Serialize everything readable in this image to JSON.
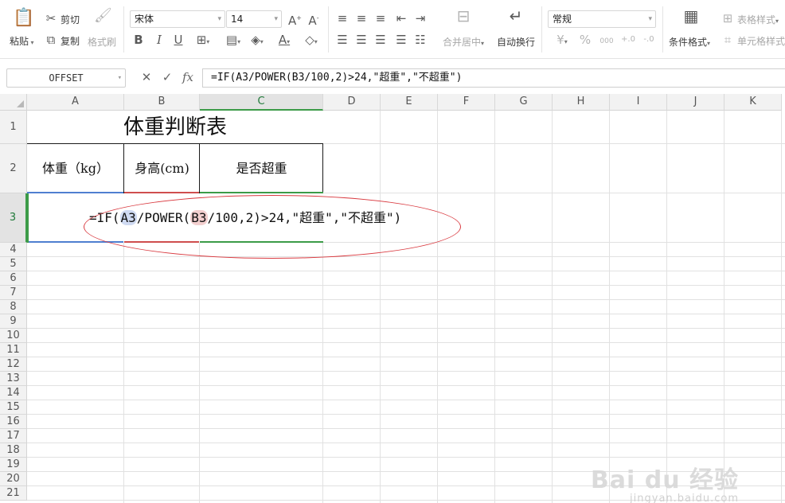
{
  "ribbon": {
    "paste_label": "粘贴",
    "cut_label": "剪切",
    "copy_label": "复制",
    "format_painter_label": "格式刷",
    "font_name": "宋体",
    "font_size": "14",
    "merge_center_label": "合并居中",
    "wrap_text_label": "自动换行",
    "number_format": "常规",
    "percent_symbol": "%",
    "thousands_symbol": "000",
    "conditional_format_label": "条件格式",
    "table_style_label": "表格样式",
    "cell_style_label": "单元格样式"
  },
  "formula_bar": {
    "name_box": "OFFSET",
    "fx_label": "fx",
    "formula": "=IF(A3/POWER(B3/100,2)>24,\"超重\",\"不超重\")"
  },
  "grid": {
    "columns": [
      "A",
      "B",
      "C",
      "D",
      "E",
      "F",
      "G",
      "H",
      "I",
      "J",
      "K"
    ],
    "rows": [
      "1",
      "2",
      "3",
      "4",
      "5",
      "6",
      "7",
      "8",
      "9",
      "10",
      "11",
      "12",
      "13",
      "14",
      "15",
      "16",
      "17",
      "18",
      "19",
      "20",
      "21"
    ],
    "title": "体重判断表",
    "header_weight": "体重（kg）",
    "header_height": "身高(cm)",
    "header_overweight": "是否超重",
    "edit": {
      "prefix": "=IF(",
      "ref_a": "A3",
      "mid": "/POWER(",
      "ref_b": "B3",
      "suffix": "/100,2)>24,\"超重\",\"不超重\")"
    }
  },
  "watermark": {
    "brand": "Bai du 经验",
    "url": "jingyan.baidu.com"
  }
}
